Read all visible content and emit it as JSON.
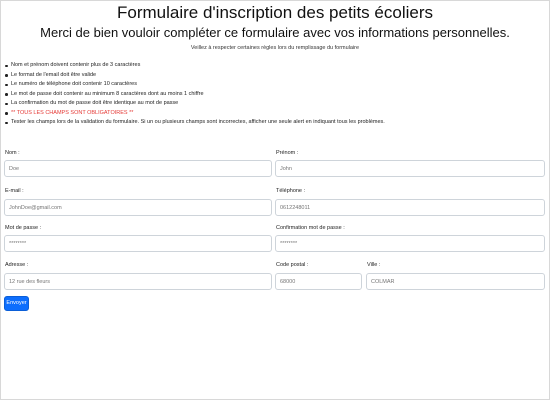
{
  "header": {
    "title": "Formulaire d'inscription des petits écoliers",
    "subtitle": "Merci de bien vouloir compléter ce formulaire avec vos informations personnelles.",
    "note": "Veillez à respecter certaines règles lors du remplissage du formulaire"
  },
  "rules": [
    "Nom et prénom doivent contenir plus de 3 caractères",
    "Le format de l'email doit être valide",
    "Le numéro de téléphone doit contenir 10 caractères",
    "Le mot de passe doit contenir au minimum 8 caractères dont au moins 1 chiffre",
    "La confirmation du mot de passe doit être identique au mot de passe",
    "** TOUS LES CHAMPS SONT OBLIGATOIRES **",
    "Tester les champs lors de la validation du formulaire. Si un ou plusieurs champs sont incorrectes, afficher une seule alert en indiquant tous les problèmes."
  ],
  "form": {
    "nom": {
      "label": "Nom :",
      "placeholder": "Doe"
    },
    "prenom": {
      "label": "Prénom :",
      "placeholder": "John"
    },
    "email": {
      "label": "E-mail :",
      "placeholder": "JohnDoe@gmail.com"
    },
    "telephone": {
      "label": "Téléphone :",
      "placeholder": "0612248011"
    },
    "password": {
      "label": "Mot de passe :",
      "placeholder": "********"
    },
    "password_confirm": {
      "label": "Confirmation mot de passe :",
      "placeholder": "********"
    },
    "adresse": {
      "label": "Adresse :",
      "placeholder": "12 rue des fleurs"
    },
    "code_postal": {
      "label": "Code postal :",
      "placeholder": "68000"
    },
    "ville": {
      "label": "Ville :",
      "placeholder": "COLMAR"
    },
    "submit_label": "Envoyer"
  },
  "colors": {
    "warning_text": "#e53935",
    "button_primary": "#0d6efd",
    "input_border": "#ced4da"
  }
}
